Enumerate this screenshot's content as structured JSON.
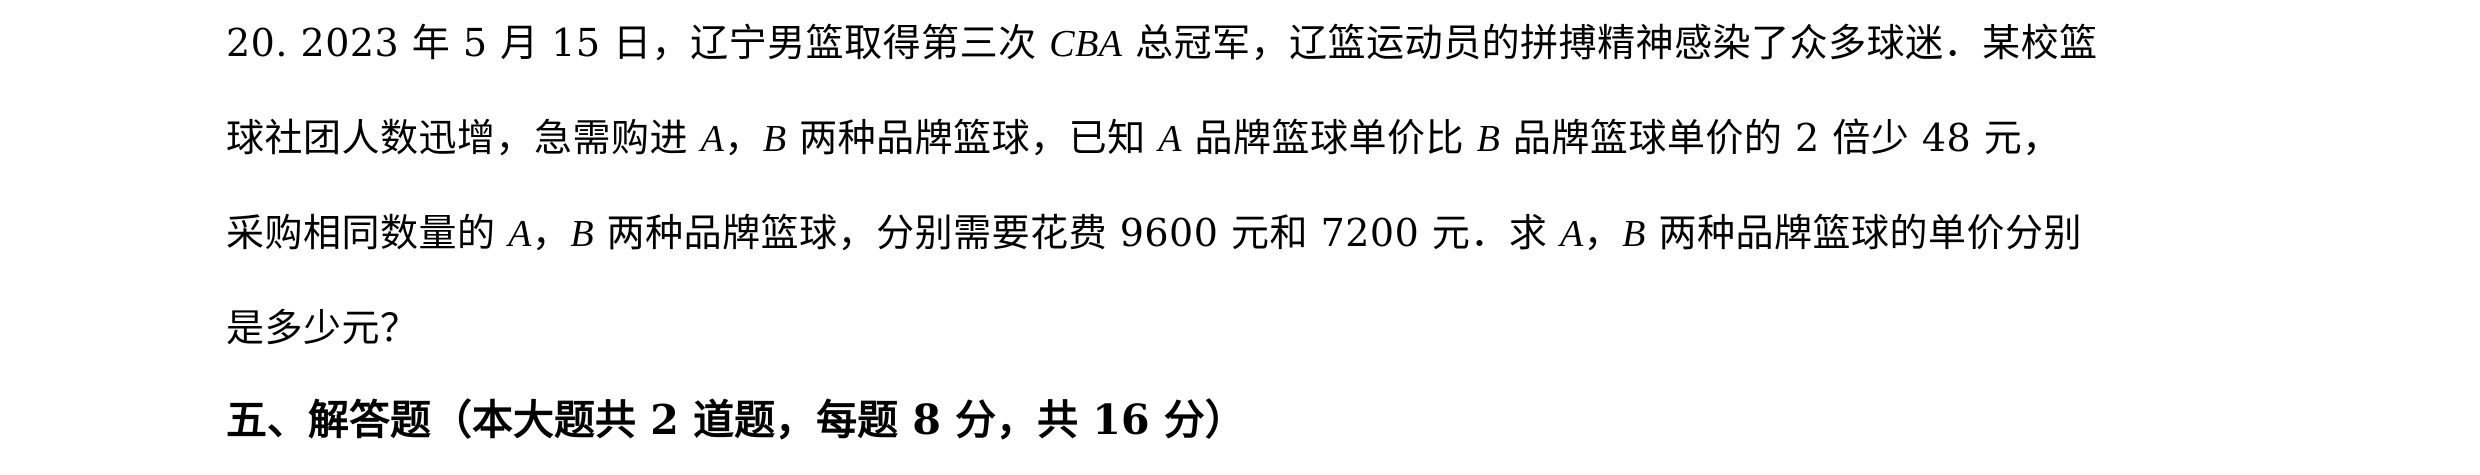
{
  "problem": {
    "line1": [
      {
        "t": "20. 2023 年 5 月 15 日，辽宁男篮取得第三次 "
      },
      {
        "t": "CBA",
        "italic": true
      },
      {
        "t": " 总冠军，辽篮运动员的拼搏精神感染了众多球迷．某校篮"
      }
    ],
    "line2": [
      {
        "t": "球社团人数迅增，急需购进 "
      },
      {
        "t": "A",
        "italic": true
      },
      {
        "t": "，"
      },
      {
        "t": "B",
        "italic": true
      },
      {
        "t": " 两种品牌篮球，已知 "
      },
      {
        "t": "A",
        "italic": true
      },
      {
        "t": " 品牌篮球单价比 "
      },
      {
        "t": "B",
        "italic": true
      },
      {
        "t": " 品牌篮球单价的 2 倍少 48 元，"
      }
    ],
    "line3": [
      {
        "t": "采购相同数量的 "
      },
      {
        "t": "A",
        "italic": true
      },
      {
        "t": "，"
      },
      {
        "t": "B",
        "italic": true
      },
      {
        "t": " 两种品牌篮球，分别需要花费 9600 元和 7200 元．求 "
      },
      {
        "t": "A",
        "italic": true
      },
      {
        "t": "，"
      },
      {
        "t": "B",
        "italic": true
      },
      {
        "t": " 两种品牌篮球的单价分别"
      }
    ],
    "line4": [
      {
        "t": "是多少元？"
      }
    ]
  },
  "section_heading": "五、解答题（本大题共 2 道题，每题 8 分，共 16 分）"
}
